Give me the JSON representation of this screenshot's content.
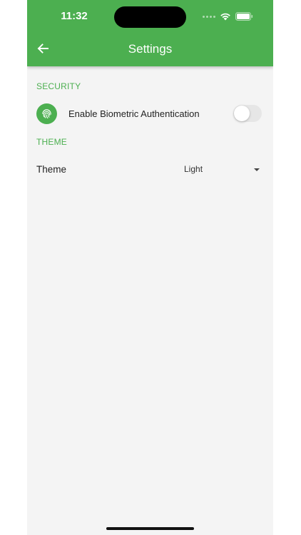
{
  "status_bar": {
    "time": "11:32"
  },
  "app_bar": {
    "title": "Settings",
    "back_icon": "arrow-back-icon",
    "color": "#4caf50"
  },
  "sections": {
    "security": {
      "header": "SECURITY",
      "biometric": {
        "label": "Enable Biometric Authentication",
        "icon": "fingerprint-icon",
        "enabled": false
      }
    },
    "theme": {
      "header": "THEME",
      "row_label": "Theme",
      "selected": "Light"
    }
  },
  "colors": {
    "accent": "#4caf50",
    "background": "#f4f4f4",
    "text": "#222222"
  }
}
